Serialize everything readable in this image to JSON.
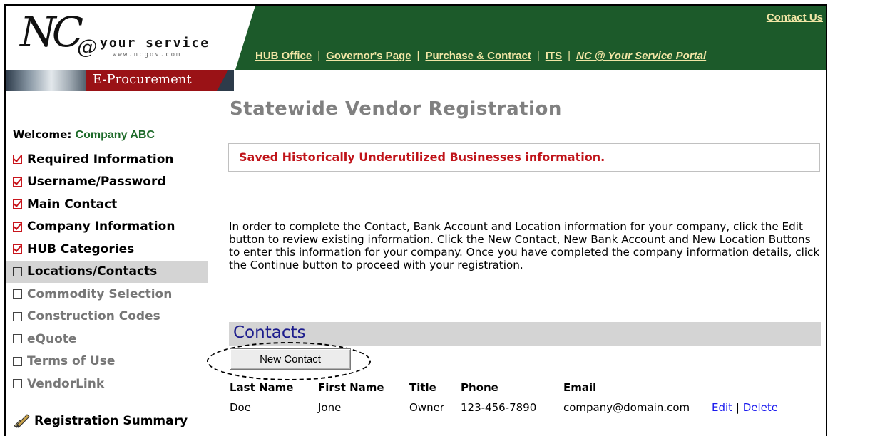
{
  "header": {
    "logo": {
      "nc": "NC",
      "at": "@",
      "service": "your service",
      "url": "www.ncgov.com"
    },
    "contact_us": "Contact Us",
    "nav": [
      {
        "label": "HUB Office"
      },
      {
        "label": "Governor's Page"
      },
      {
        "label": "Purchase & Contract"
      },
      {
        "label": "ITS"
      },
      {
        "label": "NC @ Your Service Portal"
      }
    ],
    "banner": "E-Procurement",
    "colors": {
      "green": "#1c5a2a",
      "link_yellow": "#f2e6a6",
      "banner_red": "#9a1216"
    }
  },
  "sidebar": {
    "welcome_label": "Welcome:",
    "company": "Company ABC",
    "items": [
      {
        "label": "Required Information",
        "state": "done"
      },
      {
        "label": "Username/Password",
        "state": "done"
      },
      {
        "label": "Main Contact",
        "state": "done"
      },
      {
        "label": "Company Information",
        "state": "done"
      },
      {
        "label": "HUB Categories",
        "state": "done"
      },
      {
        "label": "Locations/Contacts",
        "state": "current"
      },
      {
        "label": "Commodity Selection",
        "state": "pending"
      },
      {
        "label": "Construction Codes",
        "state": "pending"
      },
      {
        "label": "eQuote",
        "state": "pending"
      },
      {
        "label": "Terms of Use",
        "state": "pending"
      },
      {
        "label": "VendorLink",
        "state": "pending"
      }
    ],
    "summary": "Registration Summary"
  },
  "main": {
    "title": "Statewide Vendor Registration",
    "message": "Saved Historically Underutilized Businesses information.",
    "instructions": "In order to complete the Contact, Bank Account and Location information for your company, click the Edit button to review existing information. Click the New Contact, New Bank Account and New Location Buttons to enter this information for your company. Once you have completed the company information details, click the Continue button to proceed with your registration.",
    "contacts": {
      "title": "Contacts",
      "new_button": "New Contact",
      "headers": {
        "last": "Last Name",
        "first": "First Name",
        "title": "Title",
        "phone": "Phone",
        "email": "Email"
      },
      "rows": [
        {
          "last": "Doe",
          "first": "Jone",
          "title": "Owner",
          "phone": "123-456-7890",
          "email": "company@domain.com",
          "edit": "Edit",
          "sep": "|",
          "delete": "Delete"
        }
      ]
    }
  }
}
